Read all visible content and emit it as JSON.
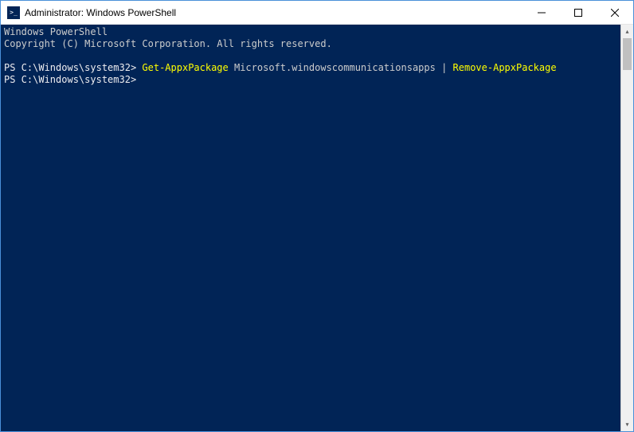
{
  "titlebar": {
    "title": "Administrator: Windows PowerShell"
  },
  "terminal": {
    "header_line1": "Windows PowerShell",
    "header_line2": "Copyright (C) Microsoft Corporation. All rights reserved.",
    "prompt1_prefix": "PS C:\\Windows\\system32> ",
    "cmd1_part1": "Get-AppxPackage ",
    "cmd1_arg": "Microsoft.windowscommunicationsapps ",
    "cmd1_pipe": "| ",
    "cmd1_part2": "Remove-AppxPackage",
    "prompt2_prefix": "PS C:\\Windows\\system32>"
  }
}
